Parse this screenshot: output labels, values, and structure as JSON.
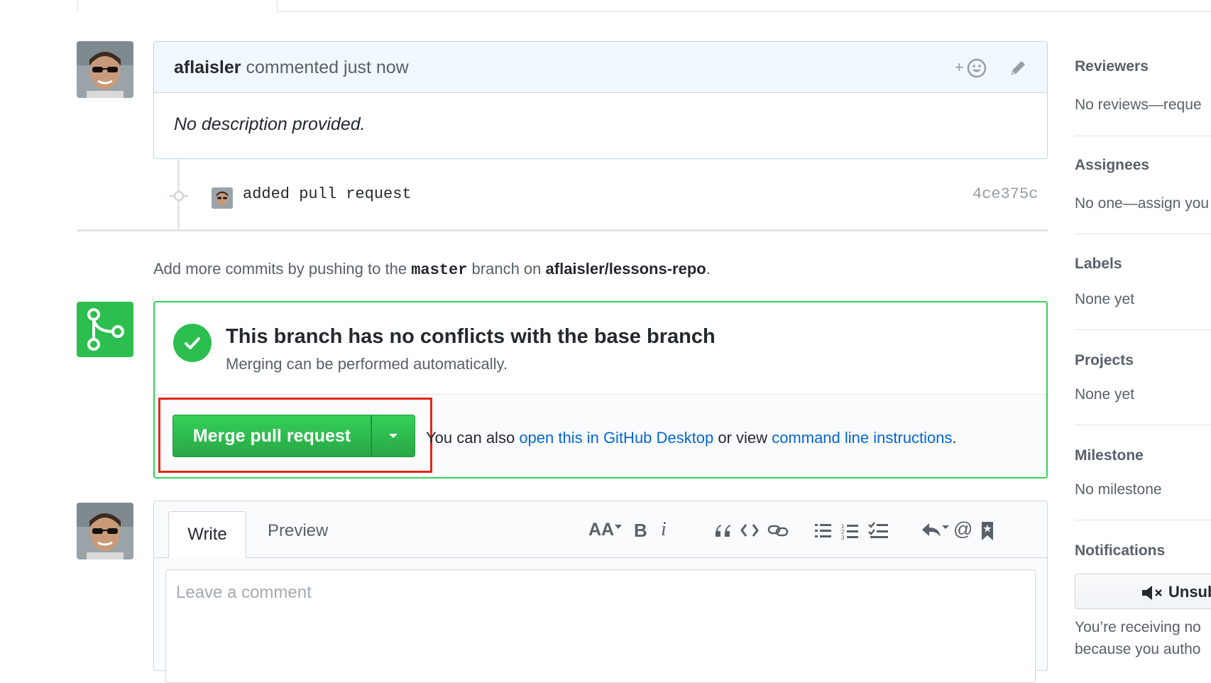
{
  "comment": {
    "author": "aflaisler",
    "action": "commented just now",
    "body": "No description provided."
  },
  "commit": {
    "message": "added pull request",
    "sha": "4ce375c"
  },
  "add_commits": {
    "prefix": "Add more commits by pushing to the",
    "branch": "master",
    "middle": "branch on",
    "repo": "aflaisler/lessons-repo",
    "suffix": "."
  },
  "merge": {
    "title": "This branch has no conflicts with the base branch",
    "subtitle": "Merging can be performed automatically.",
    "button_label": "Merge pull request",
    "text_prefix": "You can also",
    "link_desktop": "open this in GitHub Desktop",
    "text_middle": "or view",
    "link_cli": "command line instructions",
    "text_suffix": "."
  },
  "editor": {
    "tab_write": "Write",
    "tab_preview": "Preview",
    "placeholder": "Leave a comment",
    "toolbar": {
      "header": "AA",
      "bold": "B",
      "italic": "i",
      "mention": "@"
    }
  },
  "sidebar": {
    "reviewers": {
      "label": "Reviewers",
      "value": "No reviews—reque"
    },
    "assignees": {
      "label": "Assignees",
      "value": "No one—assign you"
    },
    "labels": {
      "label": "Labels",
      "value": "None yet"
    },
    "projects": {
      "label": "Projects",
      "value": "None yet"
    },
    "milestone": {
      "label": "Milestone",
      "value": "No milestone"
    },
    "notifications": {
      "label": "Notifications",
      "button": "Unsub",
      "note_line1": "You’re receiving no",
      "note_line2": "because you autho"
    }
  },
  "colors": {
    "green": "#2cbe4e",
    "link": "#0366d6",
    "highlight_red": "#e3261b",
    "comment_header_bg": "#f1f8ff"
  },
  "icons": [
    "smiley-icon",
    "pencil-icon",
    "git-commit-icon",
    "git-merge-icon",
    "check-icon",
    "caret-down-icon",
    "mute-icon",
    "quote-icon",
    "code-icon",
    "link-icon",
    "list-icon",
    "ordered-list-icon",
    "tasklist-icon",
    "reply-icon",
    "bookmark-icon"
  ]
}
